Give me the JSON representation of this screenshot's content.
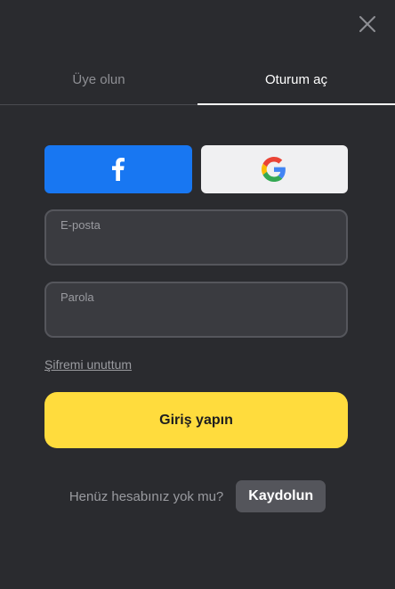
{
  "header": {
    "close_icon": "close-icon"
  },
  "tabs": [
    {
      "label": "Üye olun",
      "active": false
    },
    {
      "label": "Oturum aç",
      "active": true
    }
  ],
  "social": {
    "facebook_icon": "facebook-icon",
    "google_icon": "google-icon",
    "facebook_color": "#1877f2"
  },
  "form": {
    "email_label": "E-posta",
    "email_value": "",
    "password_label": "Parola",
    "password_value": "",
    "forgot_label": "Şifremi unuttum",
    "submit_label": "Giriş yapın"
  },
  "footer": {
    "prompt": "Henüz hesabınız yok mu?",
    "signup_label": "Kaydolun"
  },
  "colors": {
    "background": "#2a2b2f",
    "accent": "#ffdc3d"
  }
}
